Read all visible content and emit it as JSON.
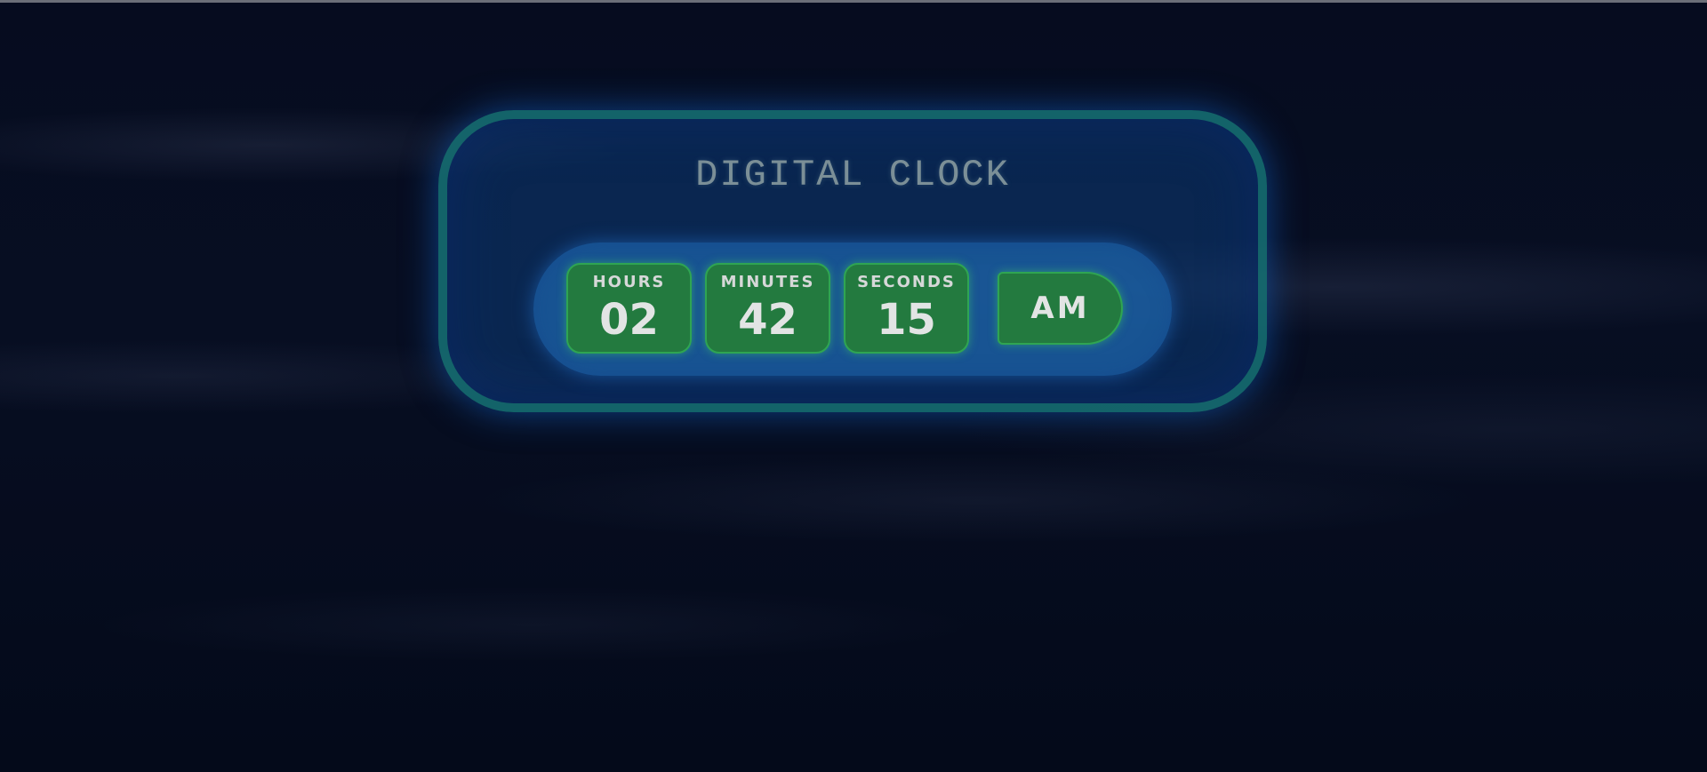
{
  "clock": {
    "title": "DIGITAL CLOCK",
    "hours": {
      "label": "HOURS",
      "value": "02"
    },
    "minutes": {
      "label": "MINUTES",
      "value": "42"
    },
    "seconds": {
      "label": "SECONDS",
      "value": "15"
    },
    "period": "AM"
  },
  "colors": {
    "background": "#050b1c",
    "card_border": "#18786f",
    "card_fill": "#0c3c78",
    "tile_fill": "#237a3f",
    "tile_border": "#2fa552",
    "title_text": "#7b8f97",
    "digit_text": "#e2e4e4"
  }
}
